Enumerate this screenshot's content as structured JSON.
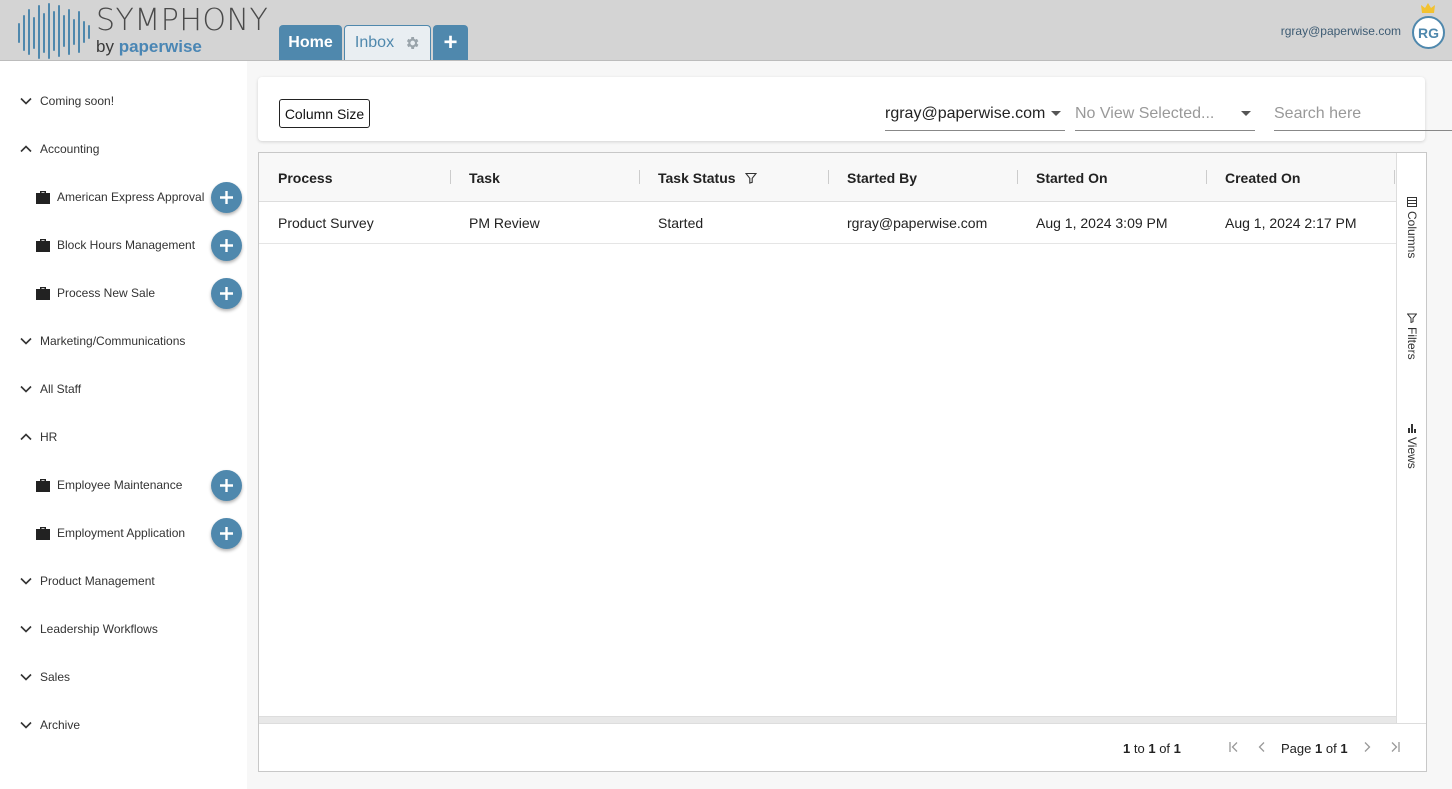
{
  "app": {
    "logo_title": "SYMPHONY",
    "logo_by": "by",
    "logo_brand": "paperwise",
    "accent": "#4f88ad"
  },
  "tabs": [
    {
      "label": "Home",
      "active": true
    },
    {
      "label": "Inbox",
      "icon": "gear-icon"
    },
    {
      "label": "+",
      "icon": "plus-icon"
    }
  ],
  "user": {
    "email": "rgray@paperwise.com",
    "initials": "RG",
    "badge_icon": "crown-icon"
  },
  "sidebar": {
    "categories": [
      {
        "label": "Coming soon!",
        "expanded": false
      },
      {
        "label": "Accounting",
        "expanded": true,
        "items": [
          "American Express Approval",
          "Block Hours Management",
          "Process New Sale"
        ]
      },
      {
        "label": "Marketing/Communications",
        "expanded": false
      },
      {
        "label": "All Staff",
        "expanded": false
      },
      {
        "label": "HR",
        "expanded": true,
        "items": [
          "Employee Maintenance",
          "Employment Application"
        ]
      },
      {
        "label": "Product Management",
        "expanded": false
      },
      {
        "label": "Leadership Workflows",
        "expanded": false
      },
      {
        "label": "Sales",
        "expanded": false
      },
      {
        "label": "Archive",
        "expanded": false
      }
    ]
  },
  "toolbar": {
    "column_size_label": "Column Size",
    "user_select_value": "rgray@paperwise.com",
    "view_select_placeholder": "No View Selected...",
    "search_placeholder": "Search here"
  },
  "grid": {
    "columns": [
      "Process",
      "Task",
      "Task Status",
      "Started By",
      "Started On",
      "Created On"
    ],
    "rows": [
      [
        "Product Survey",
        "PM Review",
        "Started",
        "rgray@paperwise.com",
        "Aug 1, 2024 3:09 PM",
        "Aug 1, 2024 2:17 PM"
      ]
    ],
    "side_tabs": [
      "Columns",
      "Filters",
      "Views"
    ],
    "footer": {
      "from": "1",
      "to_word": "to",
      "to": "1",
      "of_word": "of",
      "total": "1",
      "page_word": "Page",
      "page": "1",
      "page_of_word": "of",
      "page_total": "1"
    }
  }
}
